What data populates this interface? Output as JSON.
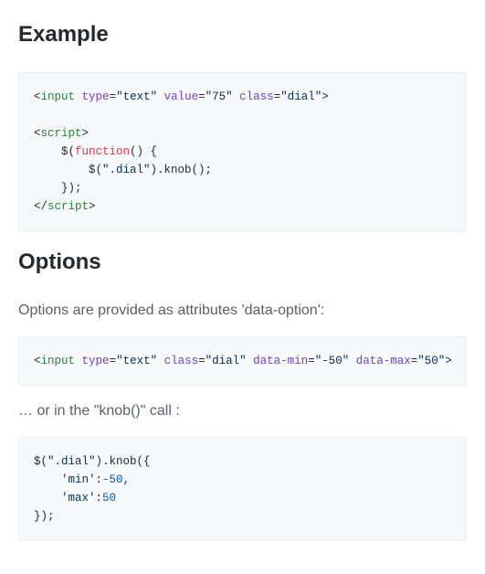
{
  "sections": {
    "example": {
      "heading": "Example"
    },
    "options": {
      "heading": "Options",
      "intro": "Options are provided as attributes 'data-option':",
      "or_text": "… or in the \"knob()\" call :"
    }
  },
  "code": {
    "example": {
      "tag_input": "input",
      "attr_type": "type",
      "val_type": "\"text\"",
      "attr_value": "value",
      "val_value": "\"75\"",
      "attr_class": "class",
      "val_class": "\"dial\"",
      "tag_script_open": "script",
      "tag_script_close": "script",
      "line_fn_open": "    $(",
      "kw_function": "function",
      "line_fn_open_tail": "() {",
      "line_knob": "        $(",
      "sel_dial": "\".dial\"",
      "line_knob_tail": ").knob();",
      "line_fn_close": "    });"
    },
    "options_attr": {
      "tag_input": "input",
      "attr_type": "type",
      "val_type": "\"text\"",
      "attr_class": "class",
      "val_class": "\"dial\"",
      "attr_datamin": "data-min",
      "val_datamin": "\"-50\"",
      "attr_datamax": "data-max",
      "val_datamax": "\"50\""
    },
    "options_call": {
      "line1_a": "$(",
      "sel_dial": "\".dial\"",
      "line1_b": ").knob({",
      "line2_a": "    ",
      "key_min": "'min'",
      "line2_b": ":",
      "val_min": "-50",
      "line2_c": ",",
      "line3_a": "    ",
      "key_max": "'max'",
      "line3_b": ":",
      "val_max": "50",
      "line4": "});"
    }
  }
}
